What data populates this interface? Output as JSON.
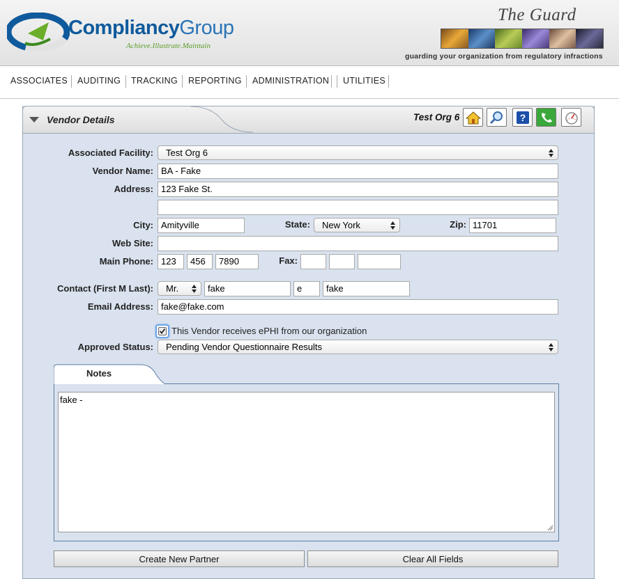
{
  "header": {
    "brand_part1": "Compliancy",
    "brand_part2": "Group",
    "brand_tagline": "Achieve.Illustrate.Maintain",
    "product_title": "The Guard",
    "product_tagline": "guarding your organization from regulatory infractions",
    "strip_colors": [
      "#c8862a",
      "#3a6fa8",
      "#8aa63c",
      "#7a5fa8",
      "#b48c6c",
      "#3b3b5a"
    ]
  },
  "nav": {
    "items": [
      {
        "label": "ASSOCIATES"
      },
      {
        "label": "AUDITING"
      },
      {
        "label": "TRACKING"
      },
      {
        "label": "REPORTING"
      },
      {
        "label": "ADMINISTRATION"
      },
      {
        "label": "UTILITIES"
      }
    ]
  },
  "panel": {
    "title": "Vendor Details",
    "org": "Test Org 6",
    "toolbar_icons": [
      "home-icon",
      "search-icon",
      "help-icon",
      "phone-icon",
      "gauge-icon"
    ]
  },
  "form": {
    "facility_label": "Associated Facility:",
    "facility_value": "Test Org 6",
    "vendor_name_label": "Vendor Name:",
    "vendor_name_value": "BA - Fake",
    "address_label": "Address:",
    "address1_value": "123 Fake St.",
    "address2_value": "",
    "city_label": "City:",
    "city_value": "Amityville",
    "state_label": "State:",
    "state_value": "New York",
    "zip_label": "Zip:",
    "zip_value": "11701",
    "website_label": "Web Site:",
    "website_value": "",
    "phone_label": "Main Phone:",
    "phone_area": "123",
    "phone_prefix": "456",
    "phone_line": "7890",
    "fax_label": "Fax:",
    "fax_area": "",
    "fax_prefix": "",
    "fax_line": "",
    "contact_label": "Contact (First M Last):",
    "contact_title": "Mr.",
    "contact_first": "fake",
    "contact_middle": "e",
    "contact_last": "fake",
    "email_label": "Email Address:",
    "email_value": "fake@fake.com",
    "ephi_checked": true,
    "ephi_label": "This Vendor receives ePHI from our organization",
    "status_label": "Approved Status:",
    "status_value": "Pending Vendor Questionnaire Results"
  },
  "notes": {
    "tab_label": "Notes",
    "text": "fake -"
  },
  "actions": {
    "create_label": "Create New Partner",
    "clear_label": "Clear All Fields"
  }
}
